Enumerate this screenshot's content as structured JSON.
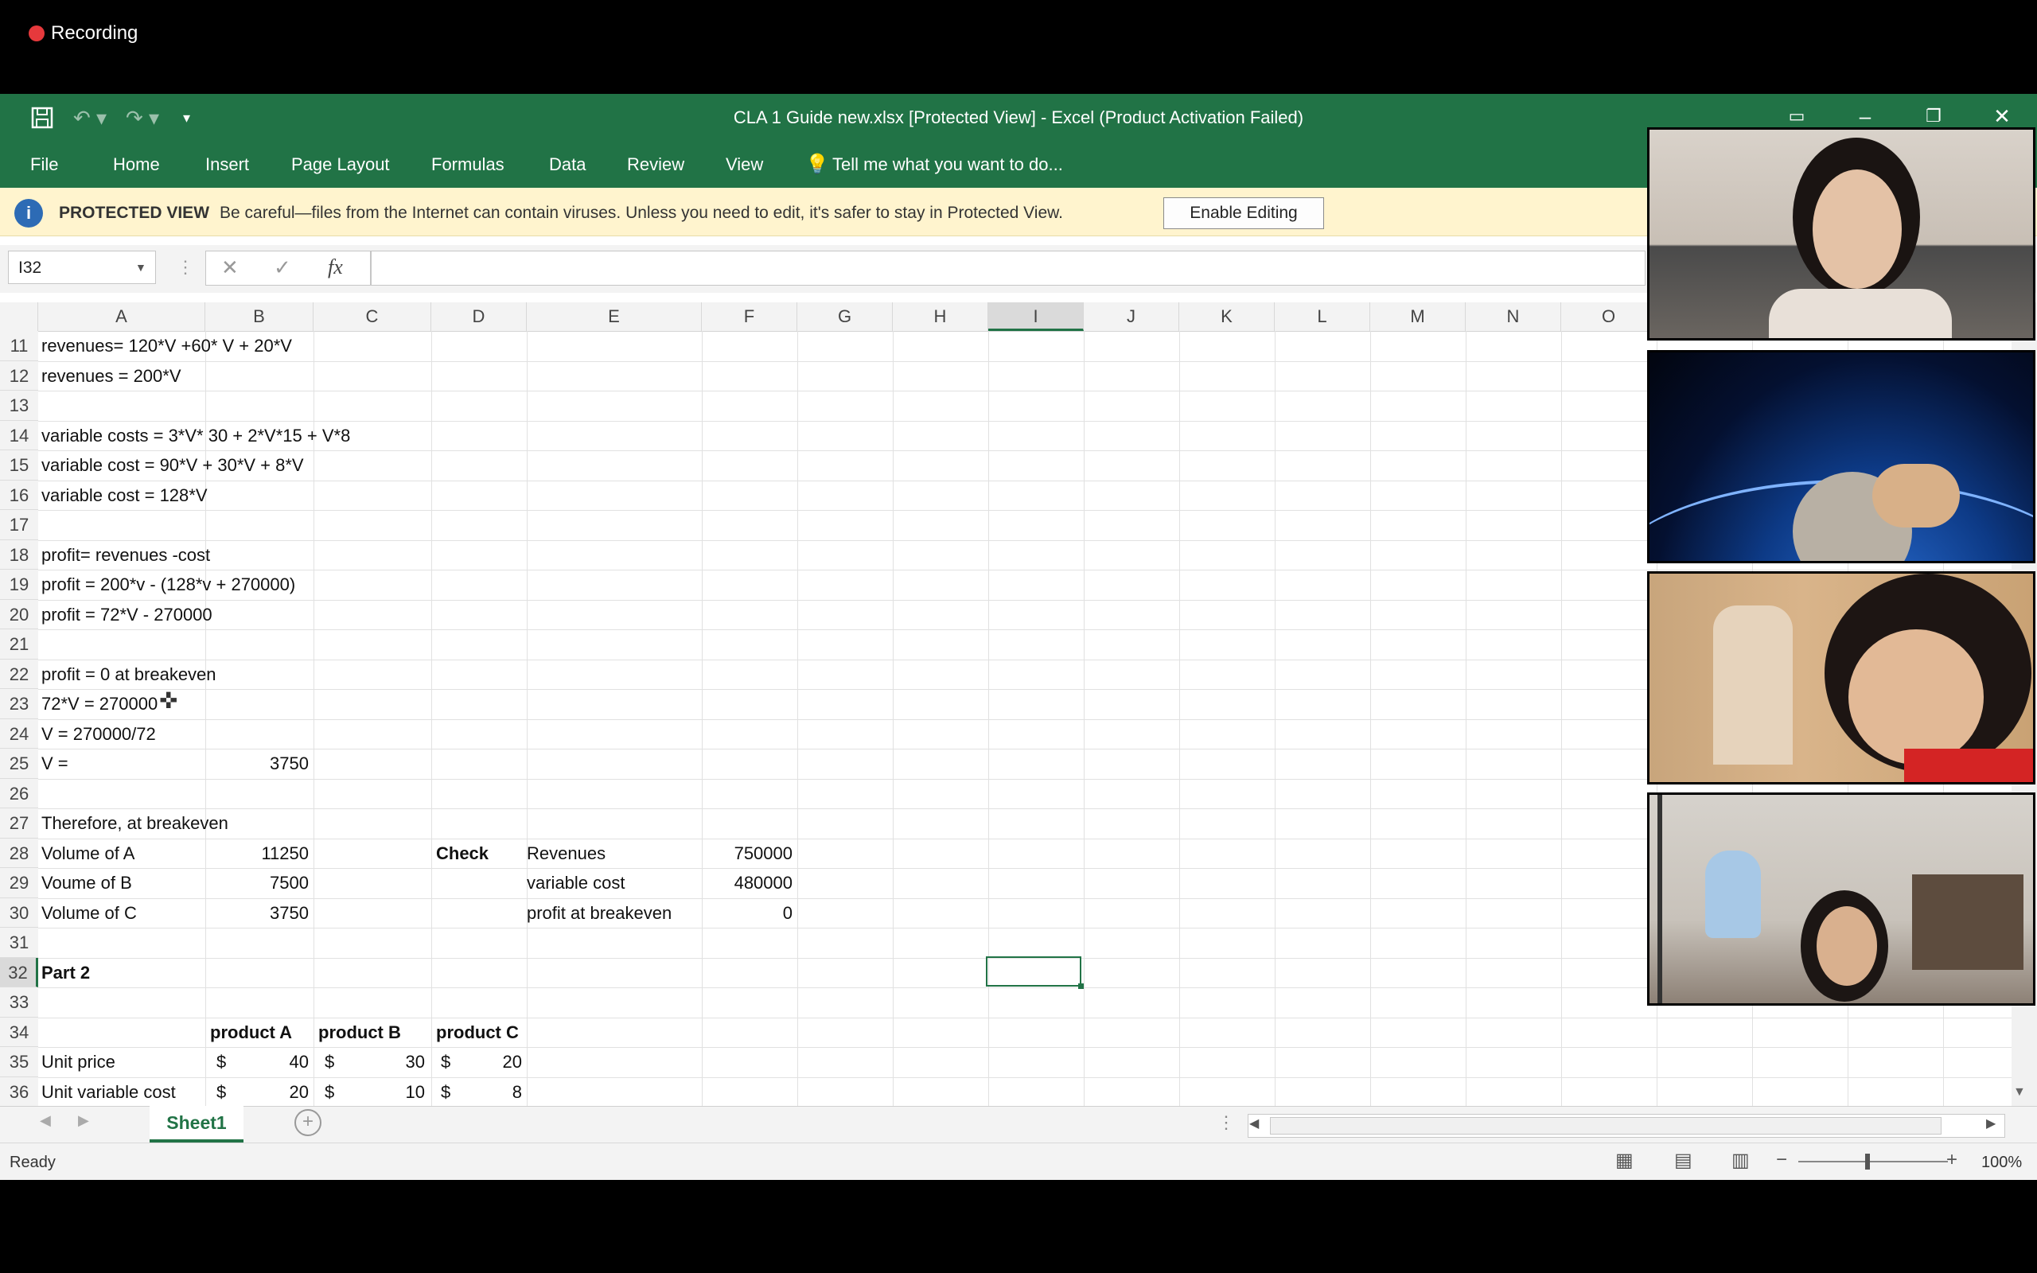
{
  "recording": {
    "label": "Recording"
  },
  "window": {
    "title": "CLA 1 Guide new.xlsx  [Protected View] - Excel (Product Activation Failed)",
    "save_icon": "save-icon",
    "undo_icon": "undo-icon",
    "redo_icon": "redo-icon"
  },
  "ribbon": {
    "tabs": [
      "File",
      "Home",
      "Insert",
      "Page Layout",
      "Formulas",
      "Data",
      "Review",
      "View"
    ],
    "tell_me": "Tell me what you want to do..."
  },
  "protected_view": {
    "title": "PROTECTED VIEW",
    "message": "Be careful—files from the Internet can contain viruses. Unless you need to edit, it's safer to stay in Protected View.",
    "button": "Enable Editing"
  },
  "formula_bar": {
    "name_box": "I32",
    "fx": "fx",
    "formula": ""
  },
  "columns": [
    "A",
    "B",
    "C",
    "D",
    "E",
    "F",
    "G",
    "H",
    "I",
    "J",
    "K",
    "L",
    "M",
    "N",
    "O"
  ],
  "rows": [
    {
      "num": "11",
      "a": "revenues= 120*V +60* V + 20*V"
    },
    {
      "num": "12",
      "a": "revenues = 200*V"
    },
    {
      "num": "13"
    },
    {
      "num": "14",
      "a": "variable costs = 3*V* 30 + 2*V*15 + V*8"
    },
    {
      "num": "15",
      "a": "variable cost = 90*V + 30*V + 8*V"
    },
    {
      "num": "16",
      "a": "variable cost = 128*V"
    },
    {
      "num": "17"
    },
    {
      "num": "18",
      "a": "profit= revenues -cost"
    },
    {
      "num": "19",
      "a": "profit = 200*v - (128*v + 270000)"
    },
    {
      "num": "20",
      "a": "profit = 72*V - 270000"
    },
    {
      "num": "21"
    },
    {
      "num": "22",
      "a": "profit = 0 at breakeven"
    },
    {
      "num": "23",
      "a": "72*V = 270000"
    },
    {
      "num": "24",
      "a": "V = 270000/72"
    },
    {
      "num": "25",
      "a": "V =",
      "b": "3750"
    },
    {
      "num": "26"
    },
    {
      "num": "27",
      "a": "Therefore, at breakeven"
    },
    {
      "num": "28",
      "a": "Volume of A",
      "b": "11250",
      "d": "Check",
      "e": "Revenues",
      "f": "750000"
    },
    {
      "num": "29",
      "a": "Voume of B",
      "b": "7500",
      "e": "variable cost",
      "f": "480000"
    },
    {
      "num": "30",
      "a": "Volume of C",
      "b": "3750",
      "e": "profit at breakeven",
      "f": "0"
    },
    {
      "num": "31"
    },
    {
      "num": "32",
      "a": "Part 2"
    },
    {
      "num": "33"
    },
    {
      "num": "34",
      "b": "product A",
      "c": "product B",
      "d": "product C"
    },
    {
      "num": "35",
      "a": "Unit price",
      "b_cur": "$",
      "b": "40",
      "c_cur": "$",
      "c": "30",
      "d_cur": "$",
      "d": "20"
    },
    {
      "num": "36",
      "a": "Unit variable cost",
      "b_cur": "$",
      "b": "20",
      "c_cur": "$",
      "c": "10",
      "d_cur": "$",
      "d": "8"
    }
  ],
  "sheet": {
    "tab": "Sheet1"
  },
  "status": {
    "ready": "Ready",
    "zoom": "100%"
  },
  "colors": {
    "excel_green": "#217346",
    "protected_bar": "#fff4ce",
    "rec_red": "#e6393c"
  }
}
